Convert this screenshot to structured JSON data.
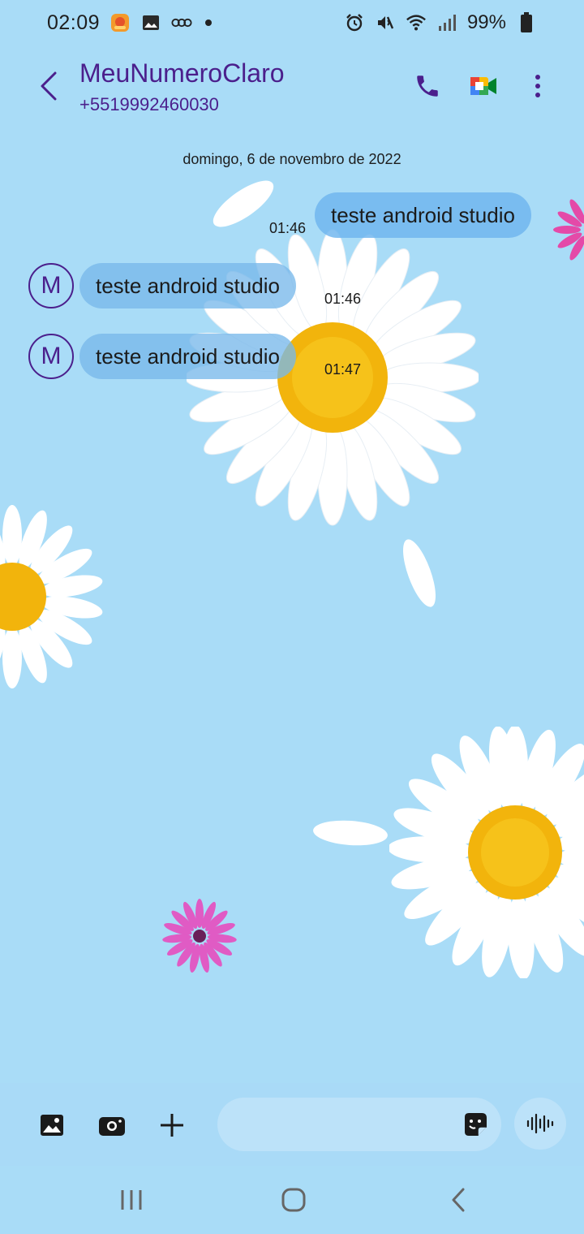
{
  "status_bar": {
    "time": "02:09",
    "battery": "99%",
    "left_icons": [
      "app-notification-icon",
      "gallery-icon",
      "voicemail-icon"
    ],
    "right_icons": [
      "alarm-icon",
      "mute-icon",
      "wifi-icon",
      "signal-icon",
      "battery-icon"
    ]
  },
  "header": {
    "contact_name": "MeuNumeroClaro",
    "contact_number": "+5519992460030",
    "actions": [
      "phone-icon",
      "video-call-icon",
      "more-options-icon"
    ],
    "accent_color": "#4b1f8c"
  },
  "conversation": {
    "date_label": "domingo, 6 de novembro de 2022",
    "messages": [
      {
        "direction": "sent",
        "text": "teste android studio",
        "time": "01:46"
      },
      {
        "direction": "received",
        "avatar": "M",
        "text": "teste android studio",
        "time": "01:46"
      },
      {
        "direction": "received",
        "avatar": "M",
        "text": "teste android studio",
        "time": "01:47"
      }
    ]
  },
  "composer": {
    "buttons": [
      "gallery-icon",
      "camera-icon",
      "add-icon",
      "sticker-icon",
      "voice-record-icon"
    ],
    "input_value": "",
    "input_placeholder": ""
  },
  "navbar": {
    "buttons": [
      "recents-icon",
      "home-icon",
      "back-icon"
    ]
  },
  "theme": {
    "background": "#a9dcf7",
    "bubble": "#78b9eb"
  }
}
